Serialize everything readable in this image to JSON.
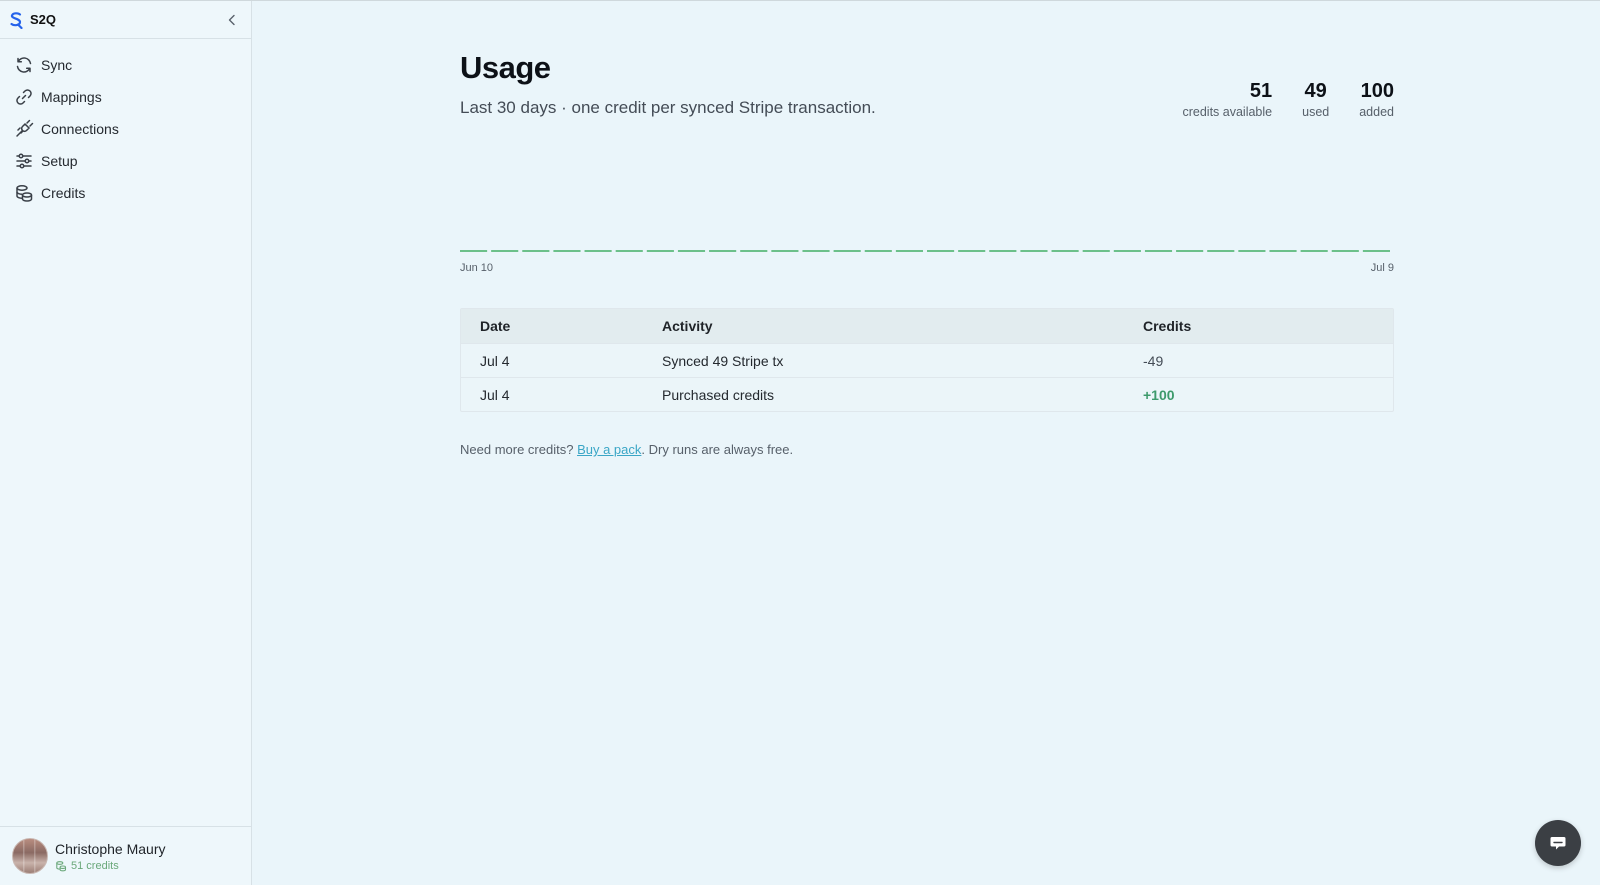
{
  "app": {
    "name": "S2Q"
  },
  "sidebar": {
    "items": [
      {
        "label": "Sync",
        "icon": "sync-icon"
      },
      {
        "label": "Mappings",
        "icon": "link-icon"
      },
      {
        "label": "Connections",
        "icon": "plug-icon"
      },
      {
        "label": "Setup",
        "icon": "sliders-icon"
      },
      {
        "label": "Credits",
        "icon": "coins-icon"
      }
    ],
    "user": {
      "name": "Christophe Maury",
      "credits": "51 credits"
    }
  },
  "page": {
    "title": "Usage",
    "subtitle": "Last 30 days · one credit per synced Stripe transaction."
  },
  "stats": [
    {
      "value": "51",
      "label": "credits available"
    },
    {
      "value": "49",
      "label": "used"
    },
    {
      "value": "100",
      "label": "added"
    }
  ],
  "chart_data": {
    "type": "bar",
    "x_start_label": "Jun 10",
    "x_end_label": "Jul 9",
    "days": 30,
    "values": [
      0,
      0,
      0,
      0,
      0,
      0,
      0,
      0,
      0,
      0,
      0,
      0,
      0,
      0,
      0,
      0,
      0,
      0,
      0,
      0,
      0,
      0,
      0,
      0,
      0,
      0,
      0,
      0,
      0,
      0
    ],
    "bar_color": "#6cc08a"
  },
  "table": {
    "headers": {
      "date": "Date",
      "activity": "Activity",
      "credits": "Credits"
    },
    "rows": [
      {
        "date": "Jul 4",
        "activity": "Synced 49 Stripe tx",
        "credits": "-49"
      },
      {
        "date": "Jul 4",
        "activity": "Purchased credits",
        "credits": "+100"
      }
    ]
  },
  "note": {
    "prefix": "Need more credits? ",
    "link": "Buy a pack",
    "suffix": ". Dry runs are always free."
  },
  "colors": {
    "accent": "#3aa6c6",
    "positive": "#3d9a6c",
    "brand": "#2563eb"
  }
}
